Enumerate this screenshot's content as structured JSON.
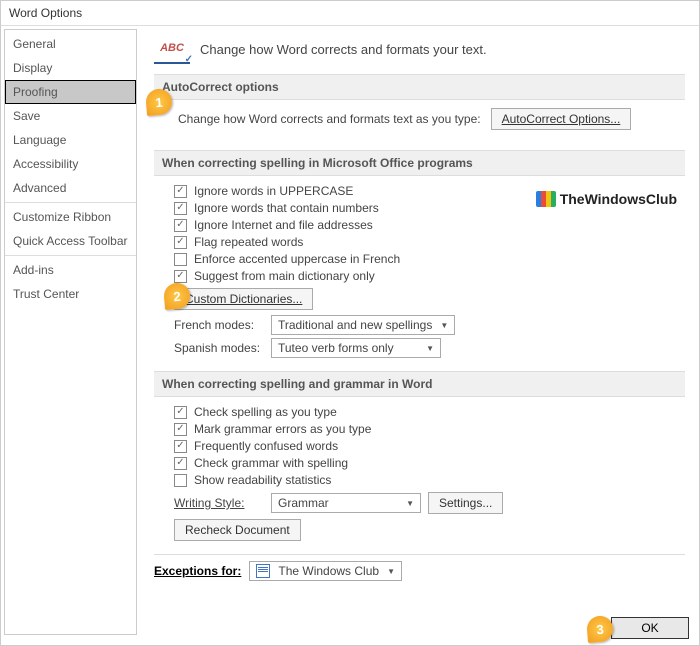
{
  "title": "Word Options",
  "sidebar": {
    "items": [
      {
        "label": "General"
      },
      {
        "label": "Display"
      },
      {
        "label": "Proofing",
        "selected": true
      },
      {
        "label": "Save"
      },
      {
        "label": "Language"
      },
      {
        "label": "Accessibility"
      },
      {
        "label": "Advanced"
      },
      {
        "label": "Customize Ribbon"
      },
      {
        "label": "Quick Access Toolbar"
      },
      {
        "label": "Add-ins"
      },
      {
        "label": "Trust Center"
      }
    ]
  },
  "header": "Change how Word corrects and formats your text.",
  "sec1": {
    "title": "AutoCorrect options",
    "desc": "Change how Word corrects and formats text as you type:",
    "btn": "AutoCorrect Options..."
  },
  "sec2": {
    "title": "When correcting spelling in Microsoft Office programs",
    "c1": "Ignore words in UPPERCASE",
    "c2": "Ignore words that contain numbers",
    "c3": "Ignore Internet and file addresses",
    "c4": "Flag repeated words",
    "c5": "Enforce accented uppercase in French",
    "c6": "Suggest from main dictionary only",
    "btn": "Custom Dictionaries...",
    "fm_label": "French modes:",
    "fm_val": "Traditional and new spellings",
    "sm_label": "Spanish modes:",
    "sm_val": "Tuteo verb forms only"
  },
  "sec3": {
    "title": "When correcting spelling and grammar in Word",
    "c1": "Check spelling as you type",
    "c2": "Mark grammar errors as you type",
    "c3": "Frequently confused words",
    "c4": "Check grammar with spelling",
    "c5": "Show readability statistics",
    "ws_label": "Writing Style:",
    "ws_val": "Grammar",
    "ws_btn": "Settings...",
    "recheck": "Recheck Document"
  },
  "exc": {
    "label": "Exceptions for:",
    "val": "The Windows Club"
  },
  "ok": "OK",
  "wm": "TheWindowsClub",
  "callouts": {
    "a": "1",
    "b": "2",
    "c": "3"
  }
}
